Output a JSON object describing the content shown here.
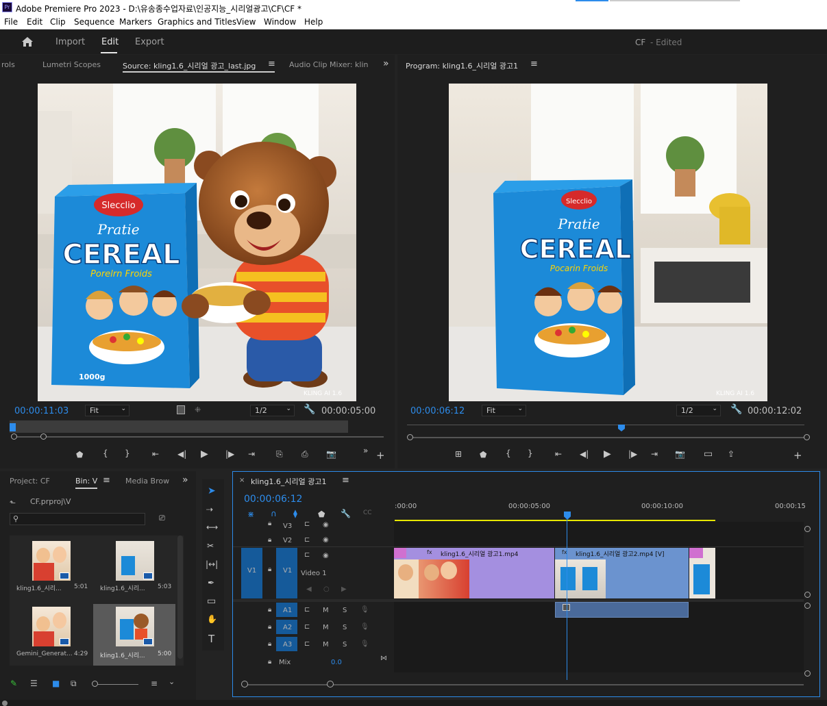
{
  "app": {
    "title": "Adobe Premiere Pro 2023 - D:\\유송종수업자료\\인공지능_시리얼광고\\CF\\CF *",
    "logo": "Pr"
  },
  "menu": [
    "File",
    "Edit",
    "Clip",
    "Sequence",
    "Markers",
    "Graphics and Titles",
    "View",
    "Window",
    "Help"
  ],
  "workspace": {
    "tabs": [
      "Import",
      "Edit",
      "Export"
    ],
    "active": "Edit",
    "project": "CF",
    "status": "- Edited"
  },
  "source": {
    "tabs": [
      "rols",
      "Lumetri Scopes",
      "Source:  kling1.6_시리얼 광고_last.jpg",
      "Audio Clip Mixer: kling"
    ],
    "timecode": "00:00:11:03",
    "fit": "Fit",
    "res": "1/2",
    "duration": "00:00:05:00",
    "box": {
      "brand": "Slecclio",
      "line1": "Pratie",
      "line2": "CEREAL",
      "line3": "Porelrn Froids",
      "weight": "1000g"
    },
    "watermark": "KLING AI 1.6"
  },
  "program": {
    "title": "Program:  kling1.6_시리얼 광고1",
    "timecode": "00:00:06:12",
    "fit": "Fit",
    "res": "1/2",
    "duration": "00:00:12:02",
    "box": {
      "brand": "Slecclio",
      "line1": "Pratie",
      "line2": "CEREAL",
      "line3": "Pocarin Froids"
    },
    "watermark": "KLING AI 1.6"
  },
  "project": {
    "tabs": [
      "Project: CF",
      "Bin: V",
      "Media Brow"
    ],
    "path": "CF.prproj\\V",
    "items": [
      {
        "name": "kling1.6_시리...",
        "dur": "5:01"
      },
      {
        "name": "kling1.6_시리...",
        "dur": "5:03"
      },
      {
        "name": "Gemini_Generat...",
        "dur": "4:29"
      },
      {
        "name": "kling1.6_시리...",
        "dur": "5:00"
      }
    ]
  },
  "timeline": {
    "title": "kling1.6_시리얼 광고1",
    "timecode": "00:00:06:12",
    "ruler": [
      ":00:00",
      "00:00:05:00",
      "00:00:10:00",
      "00:00:15"
    ],
    "tracks": {
      "v3": "V3",
      "v2": "V2",
      "v1": "V1",
      "v1name": "Video 1",
      "a1": "A1",
      "a2": "A2",
      "a3": "A3",
      "mix": "Mix",
      "mixval": "0.0",
      "m": "M",
      "s": "S"
    },
    "clips": [
      {
        "name": "kling1.6_시리얼 광고1.mp4"
      },
      {
        "name": "kling1.6_시리얼 광고2.mp4 [V]"
      }
    ]
  },
  "colors": {
    "accent": "#2d8ceb",
    "clipPurple": "#a48fe0",
    "clipBlue": "#6b93cf",
    "audioClip": "#4a6a9a"
  }
}
